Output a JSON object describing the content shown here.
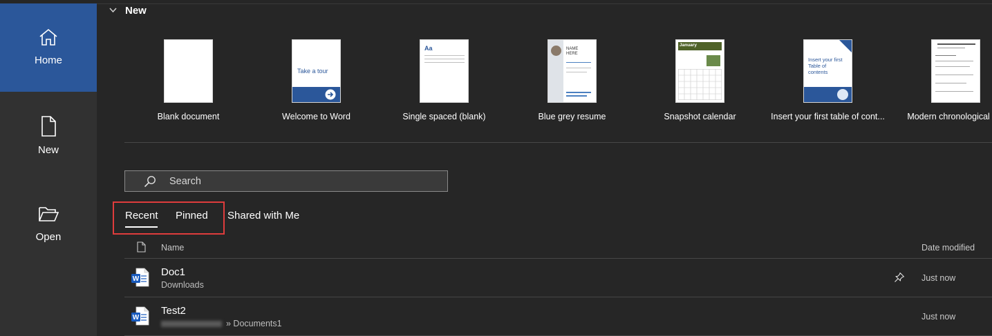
{
  "nav": {
    "home": {
      "label": "Home",
      "icon": "home-icon"
    },
    "new": {
      "label": "New",
      "icon": "new-document-icon"
    },
    "open": {
      "label": "Open",
      "icon": "folder-open-icon"
    }
  },
  "new_section": {
    "title": "New",
    "templates": [
      {
        "label": "Blank document"
      },
      {
        "label": "Welcome to Word",
        "thumb_text": "Take a tour"
      },
      {
        "label": "Single spaced (blank)",
        "thumb_text": "Aa"
      },
      {
        "label": "Blue grey resume",
        "thumb_text": "NAME HERE"
      },
      {
        "label": "Snapshot calendar",
        "thumb_text": "January"
      },
      {
        "label": "Insert your first table of cont...",
        "thumb_text": "Insert your first Table of contents"
      },
      {
        "label": "Modern chronological res"
      }
    ]
  },
  "search": {
    "placeholder": "Search"
  },
  "tabs": {
    "recent": "Recent",
    "pinned": "Pinned",
    "shared": "Shared with Me"
  },
  "list": {
    "header_name": "Name",
    "header_date": "Date modified",
    "rows": [
      {
        "name": "Doc1",
        "path": "Downloads",
        "date": "Just now",
        "pinned_icon": true
      },
      {
        "name": "Test2",
        "path": "» Documents1",
        "date": "Just now"
      }
    ]
  },
  "colors": {
    "accent": "#2b579a",
    "word_blue": "#185abd",
    "highlight": "#e03c3c",
    "background": "#262626",
    "sidebar": "#313131"
  }
}
